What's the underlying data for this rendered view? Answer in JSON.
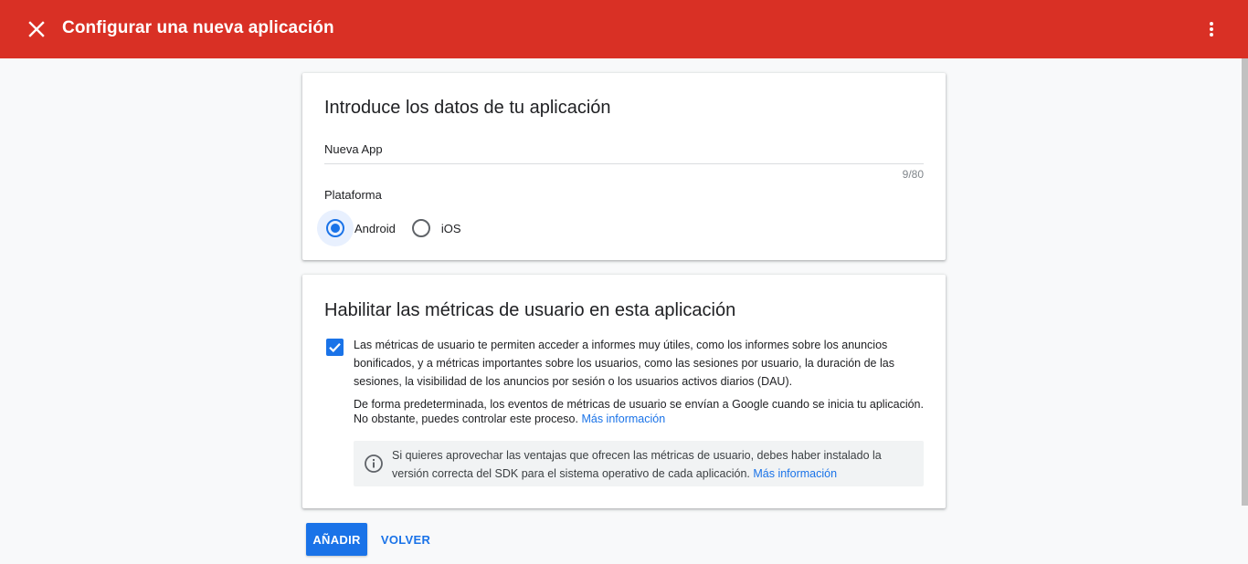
{
  "header": {
    "title": "Configurar una nueva aplicación",
    "close_icon": "close-icon",
    "menu_icon": "more-vert-icon"
  },
  "app_details": {
    "title": "Introduce los datos de tu aplicación",
    "app_name_value": "Nueva App",
    "char_counter": "9/80",
    "platform_label": "Plataforma",
    "platforms": [
      {
        "label": "Android",
        "selected": true
      },
      {
        "label": "iOS",
        "selected": false
      }
    ]
  },
  "metrics": {
    "title": "Habilitar las métricas de usuario en esta aplicación",
    "enabled": true,
    "description": "Las métricas de usuario te permiten acceder a informes muy útiles, como los informes sobre los anuncios bonificados, y a métricas importantes sobre los usuarios, como las sesiones por usuario, la duración de las sesiones, la visibilidad de los anuncios por sesión o los usuarios activos diarios (DAU).",
    "default_text": "De forma predeterminada, los eventos de métricas de usuario se envían a Google cuando se inicia tu aplicación. No obstante, puedes controlar este proceso.",
    "default_link": "Más información",
    "info_text": "Si quieres aprovechar las ventajas que ofrecen las métricas de usuario, debes haber instalado la versión correcta del SDK para el sistema operativo de cada aplicación.",
    "info_link": "Más información"
  },
  "actions": {
    "add_label": "AÑADIR",
    "back_label": "VOLVER"
  },
  "colors": {
    "header_bg": "#d93025",
    "primary": "#1a73e8"
  }
}
